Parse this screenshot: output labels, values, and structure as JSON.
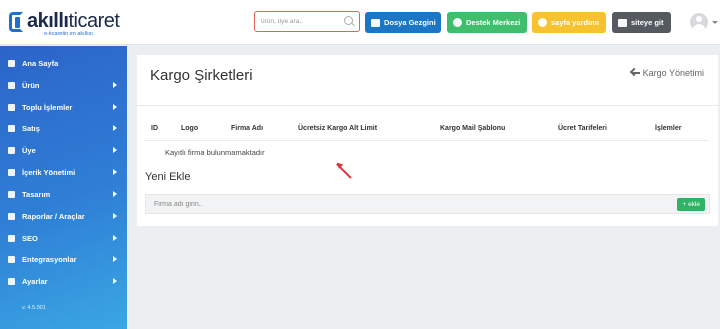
{
  "brand": {
    "logo_bold": "akıllı",
    "logo_rest": "ticaret",
    "tagline": "e-ticaretin en akıllısı",
    "accent": "#1e6fd0"
  },
  "header": {
    "search_placeholder": "ürün, üye ara..",
    "buttons": {
      "dosya": "Dosya Gezgini",
      "destek": "Destek Merkezi",
      "yardim": "sayfa yardımı",
      "siteye": "siteye git"
    }
  },
  "sidebar": {
    "items": [
      {
        "label": "Ana Sayfa",
        "icon": "home-icon",
        "has_arrow": false
      },
      {
        "label": "Ürün",
        "icon": "cube-icon",
        "has_arrow": true
      },
      {
        "label": "Toplu İşlemler",
        "icon": "bolt-icon",
        "has_arrow": true
      },
      {
        "label": "Satış",
        "icon": "cart-icon",
        "has_arrow": true
      },
      {
        "label": "Üye",
        "icon": "user-icon",
        "has_arrow": true
      },
      {
        "label": "İçerik Yönetimi",
        "icon": "document-icon",
        "has_arrow": true
      },
      {
        "label": "Tasarım",
        "icon": "palette-icon",
        "has_arrow": true
      },
      {
        "label": "Raporlar / Araçlar",
        "icon": "chart-icon",
        "has_arrow": true
      },
      {
        "label": "SEO",
        "icon": "bullseye-icon",
        "has_arrow": true
      },
      {
        "label": "Entegrasyonlar",
        "icon": "plug-icon",
        "has_arrow": true
      },
      {
        "label": "Ayarlar",
        "icon": "gear-icon",
        "has_arrow": true
      }
    ],
    "version": "v. 4.5.001"
  },
  "main": {
    "title": "Kargo Şirketleri",
    "back_link": "Kargo Yönetimi",
    "columns": [
      "ID",
      "Logo",
      "Firma Adı",
      "Ücretsiz Kargo Alt Limit",
      "Kargo Mail Şablonu",
      "Ücret Tarifeleri",
      "İşlemler"
    ],
    "empty_message": "Kayıtlı firma bulunmamaktadır",
    "add_section_title": "Yeni Ekle",
    "add_input_placeholder": "Firma adı girin..",
    "add_button": "+ ekle"
  },
  "colors": {
    "sidebar_top": "#2c64c9",
    "sidebar_bottom": "#3aa7e3",
    "dosya_button": "#1b76c6",
    "destek_button": "#3fbf6e",
    "yardim_button": "#f7c230",
    "siteye_button": "#555a60",
    "add_button": "#2fb364",
    "annotation_arrow": "#d9363e"
  }
}
